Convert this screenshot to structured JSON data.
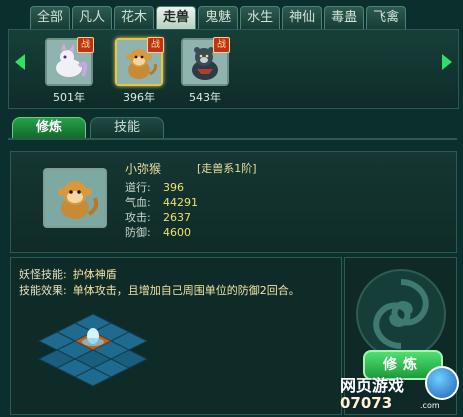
{
  "category_tabs": [
    {
      "label": "全部"
    },
    {
      "label": "凡人"
    },
    {
      "label": "花木"
    },
    {
      "label": "走兽",
      "active": true
    },
    {
      "label": "鬼魅"
    },
    {
      "label": "水生"
    },
    {
      "label": "神仙"
    },
    {
      "label": "毒蛊"
    },
    {
      "label": "飞禽"
    }
  ],
  "pets": [
    {
      "age": "501年",
      "badge": "战",
      "icon": "white-fox-pet-icon"
    },
    {
      "age": "396年",
      "badge": "战",
      "icon": "monkey-pet-icon",
      "selected": true
    },
    {
      "age": "543年",
      "badge": "战",
      "icon": "bear-pet-icon"
    }
  ],
  "sub_tabs": [
    {
      "label": "修炼",
      "active": true
    },
    {
      "label": "技能"
    }
  ],
  "pet_info": {
    "name": "小弥猴",
    "class": "[走兽系1阶]",
    "stats": [
      {
        "label": "道行:",
        "value": "396"
      },
      {
        "label": "气血:",
        "value": "44291"
      },
      {
        "label": "攻击:",
        "value": "2637"
      },
      {
        "label": "防御:",
        "value": "4600"
      }
    ]
  },
  "skill": {
    "name_label": "妖怪技能:",
    "name_value": "护体神盾",
    "effect_label": "技能效果:",
    "effect_value": "单体攻击，且增加自己周围单位的防御2回合。"
  },
  "train_button": "修炼",
  "watermark": {
    "site_cn": "网页游戏",
    "site_num": "07073",
    "site_com": ".com"
  },
  "colors": {
    "accent_green": "#2ee064",
    "highlight_gold": "#f0e06a"
  }
}
